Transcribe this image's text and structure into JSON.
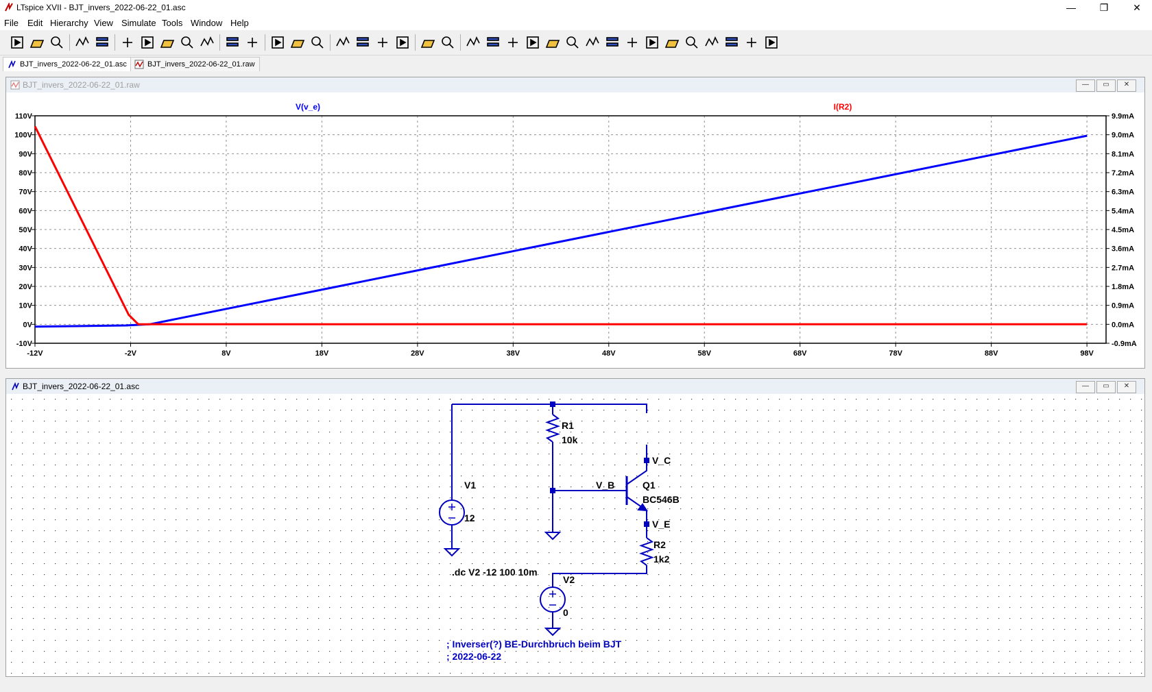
{
  "window": {
    "title": "LTspice XVII - BJT_invers_2022-06-22_01.asc",
    "controls": {
      "minimize": "—",
      "maximize": "❐",
      "close": "✕"
    }
  },
  "menu": [
    "File",
    "Edit",
    "Hierarchy",
    "View",
    "Simulate",
    "Tools",
    "Window",
    "Help"
  ],
  "toolbar": {
    "icons": [
      "run-icon",
      "open-icon",
      "save-icon",
      "control-panel-icon",
      "halt-icon",
      "pan-icon",
      "zoom-in-icon",
      "zoom-fit-icon",
      "zoom-out-icon",
      "cancel-zoom-icon",
      "autorange-icon",
      "grid-icon",
      "tile-horizontal-icon",
      "cascade-icon",
      "tile-vertical-icon",
      "cut-icon",
      "copy-icon",
      "paste-icon",
      "find-icon",
      "print-icon",
      "print-setup-icon",
      "wire-icon",
      "ground-icon",
      "label-icon",
      "resistor-icon",
      "capacitor-icon",
      "inductor-icon",
      "diode-icon",
      "component-icon",
      "move-icon",
      "drag-icon",
      "undo-icon",
      "redo-icon",
      "rotate-icon",
      "mirror-icon",
      "text-icon",
      "spice-directive-icon"
    ]
  },
  "tabs": [
    {
      "label": "BJT_invers_2022-06-22_01.asc",
      "active": true
    },
    {
      "label": "BJT_invers_2022-06-22_01.raw",
      "active": false
    }
  ],
  "plot_window": {
    "title": "BJT_invers_2022-06-22_01.raw",
    "controls": {
      "minimize": "—",
      "maximize": "▭",
      "close": "✕"
    }
  },
  "schematic_window": {
    "title": "BJT_invers_2022-06-22_01.asc",
    "controls": {
      "minimize": "—",
      "maximize": "▭",
      "close": "✕"
    }
  },
  "chart_data": {
    "type": "line",
    "series": [
      {
        "name": "V(v_e)",
        "color": "#0000ff",
        "axis": "left",
        "points": [
          [
            -12,
            -1.2
          ],
          [
            -2.5,
            -0.6
          ],
          [
            0,
            0
          ],
          [
            98,
            99.5
          ]
        ]
      },
      {
        "name": "I(R2)",
        "color": "#ff0000",
        "axis": "right",
        "points": [
          [
            -12,
            9.4
          ],
          [
            -2.2,
            0.45
          ],
          [
            -1.2,
            0
          ],
          [
            98,
            0
          ]
        ]
      }
    ],
    "x_ticks": [
      "-12V",
      "-2V",
      "8V",
      "18V",
      "28V",
      "38V",
      "48V",
      "58V",
      "68V",
      "78V",
      "88V",
      "98V"
    ],
    "x_tick_values": [
      -12,
      -2,
      8,
      18,
      28,
      38,
      48,
      58,
      68,
      78,
      88,
      98
    ],
    "xlim": [
      -12,
      100
    ],
    "y_left_ticks": [
      "110V",
      "100V",
      "90V",
      "80V",
      "70V",
      "60V",
      "50V",
      "40V",
      "30V",
      "20V",
      "10V",
      "0V",
      "-10V"
    ],
    "y_left_values": [
      110,
      100,
      90,
      80,
      70,
      60,
      50,
      40,
      30,
      20,
      10,
      0,
      -10
    ],
    "y_left_lim": [
      -10,
      110
    ],
    "y_right_ticks": [
      "9.9mA",
      "9.0mA",
      "8.1mA",
      "7.2mA",
      "6.3mA",
      "5.4mA",
      "4.5mA",
      "3.6mA",
      "2.7mA",
      "1.8mA",
      "0.9mA",
      "0.0mA",
      "-0.9mA"
    ],
    "y_right_values": [
      9.9,
      9.0,
      8.1,
      7.2,
      6.3,
      5.4,
      4.5,
      3.6,
      2.7,
      1.8,
      0.9,
      0.0,
      -0.9
    ],
    "y_right_lim": [
      -0.9,
      9.9
    ],
    "grid": true
  },
  "schematic": {
    "r1": {
      "name": "R1",
      "value": "10k"
    },
    "r2": {
      "name": "R2",
      "value": "1k2"
    },
    "v1": {
      "name": "V1",
      "value": "12"
    },
    "v2": {
      "name": "V2",
      "value": "0"
    },
    "q1": {
      "name": "Q1",
      "model": "BC546B"
    },
    "labels": {
      "vc": "V_C",
      "vb": "V_B",
      "ve": "V_E"
    },
    "directive": ".dc V2 -12 100 10m",
    "comment_line1": "; Inverser(?) BE-Durchbruch beim BJT",
    "comment_line2": "; 2022-06-22",
    "wire_color": "#0000c0",
    "text_color": "#000000",
    "comment_color": "#0000c0"
  }
}
